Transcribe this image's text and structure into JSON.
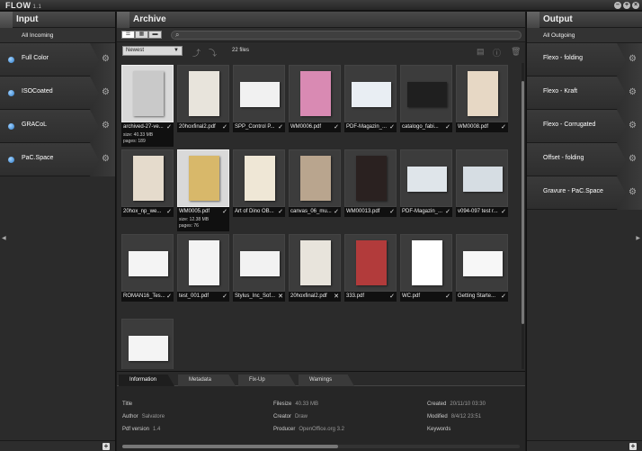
{
  "app": {
    "logo": "FLOW",
    "version": "1.1"
  },
  "input": {
    "title": "Input",
    "sub": "All Incoming",
    "items": [
      {
        "label": "Full Color"
      },
      {
        "label": "ISOCoated"
      },
      {
        "label": "GRACoL"
      },
      {
        "label": "PaC.Space"
      }
    ]
  },
  "output": {
    "title": "Output",
    "sub": "All Outgoing",
    "items": [
      {
        "label": "Flexo - folding"
      },
      {
        "label": "Flexo - Kraft"
      },
      {
        "label": "Flexo - Corrugated"
      },
      {
        "label": "Offset - folding"
      },
      {
        "label": "Gravure - PaC.Space"
      }
    ]
  },
  "archive": {
    "title": "Archive",
    "search_placeholder": "",
    "sort": "Newest",
    "count": "22 files",
    "files": [
      {
        "name": "archived-27-ve...",
        "status": "✓",
        "size": "size: 40.33 MB",
        "pages": "pages: 189",
        "color": "#c9c9c9"
      },
      {
        "name": "20hoxfinal2.pdf",
        "status": "✓",
        "color": "#e8e4dc"
      },
      {
        "name": "SPP_Control P...",
        "status": "✓",
        "color": "#f1f1f1"
      },
      {
        "name": "WM0006.pdf",
        "status": "✓",
        "color": "#d98ab3"
      },
      {
        "name": "PDF-Magazin_...",
        "status": "✓",
        "color": "#e9eef3"
      },
      {
        "name": "catalogo_fabi...",
        "status": "✓",
        "color": "#1f1f1f"
      },
      {
        "name": "WM0008.pdf",
        "status": "✓",
        "color": "#e7d8c5"
      },
      {
        "name": "20hox_np_we...",
        "status": "✓",
        "color": "#e5dbcc"
      },
      {
        "name": "WM0005.pdf",
        "status": "✓",
        "size": "size: 12.38 MB",
        "pages": "pages: 76",
        "color": "#d8b86a"
      },
      {
        "name": "Art of Dino OB...",
        "status": "✓",
        "color": "#efe7d6"
      },
      {
        "name": "canvas_06_mu...",
        "status": "✓",
        "color": "#b9a58e"
      },
      {
        "name": "WM00013.pdf",
        "status": "✓",
        "color": "#2a2120"
      },
      {
        "name": "PDF-Magazin_...",
        "status": "✓",
        "color": "#dfe5ea"
      },
      {
        "name": "v094-097 test r...",
        "status": "✓",
        "color": "#d6dde3"
      },
      {
        "name": "ROMAN16_Tes...",
        "status": "✓",
        "color": "#f4f4f4"
      },
      {
        "name": "test_001.pdf",
        "status": "✓",
        "color": "#f3f3f3"
      },
      {
        "name": "Stylus_Inc_Sof...",
        "status": "✕",
        "color": "#f2f2f2"
      },
      {
        "name": "20hoxfinal2.pdf",
        "status": "✕",
        "color": "#e8e4dc"
      },
      {
        "name": "333.pdf",
        "status": "✓",
        "color": "#b23b3b"
      },
      {
        "name": "WC.pdf",
        "status": "✓",
        "color": "#ffffff"
      },
      {
        "name": "Getting Starte...",
        "status": "✓",
        "color": "#f7f7f7"
      },
      {
        "name": "",
        "status": "",
        "color": "#f4f4f4"
      }
    ]
  },
  "info": {
    "tabs": [
      "Information",
      "Metadata",
      "Fix-Up",
      "Warnings"
    ],
    "fields": {
      "title": {
        "k": "Title",
        "v": ""
      },
      "author": {
        "k": "Author",
        "v": "Salvatore"
      },
      "pdfver": {
        "k": "Pdf version",
        "v": "1.4"
      },
      "filesize": {
        "k": "Filesize",
        "v": "40.33 MB"
      },
      "creator": {
        "k": "Creator",
        "v": "Draw"
      },
      "producer": {
        "k": "Producer",
        "v": "OpenOffice.org 3.2"
      },
      "created": {
        "k": "Created",
        "v": "20/11/10 03:30"
      },
      "modified": {
        "k": "Modified",
        "v": "8/4/12 23:51"
      },
      "keywords": {
        "k": "Keywords",
        "v": ""
      }
    }
  }
}
